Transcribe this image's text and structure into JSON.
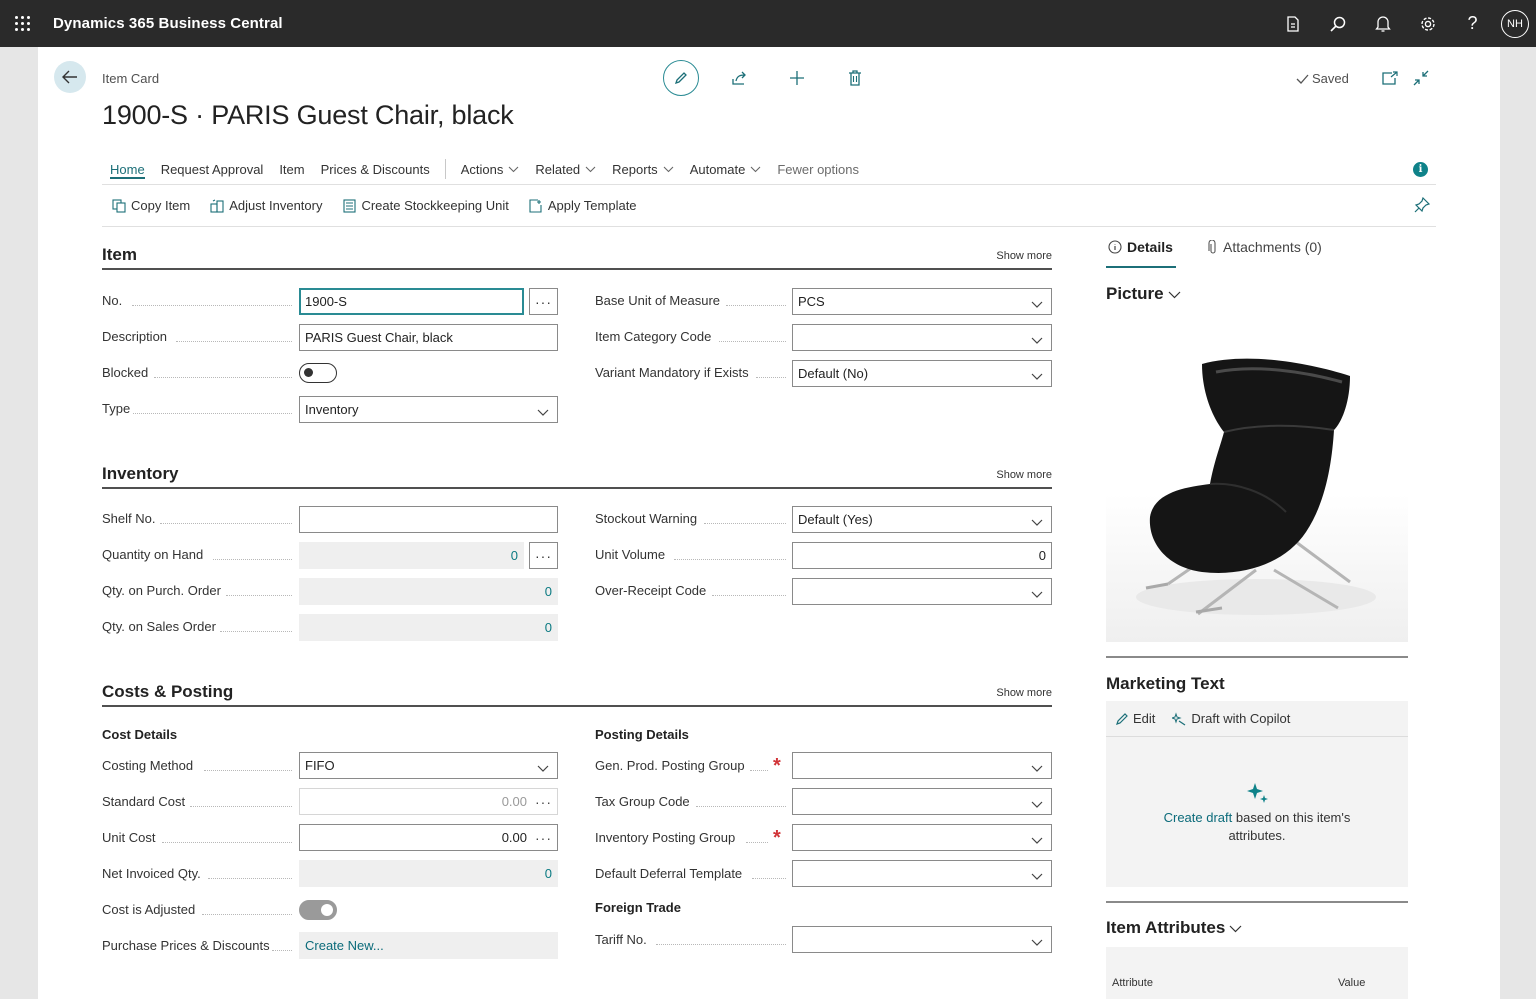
{
  "app": {
    "title": "Dynamics 365 Business Central",
    "user_initials": "NH"
  },
  "header": {
    "caption": "Item Card",
    "title": "1900-S · PARIS Guest Chair, black",
    "saved_label": "Saved"
  },
  "tabs": [
    {
      "label": "Home"
    },
    {
      "label": "Request Approval"
    },
    {
      "label": "Item"
    },
    {
      "label": "Prices & Discounts"
    },
    {
      "label": "Actions"
    },
    {
      "label": "Related"
    },
    {
      "label": "Reports"
    },
    {
      "label": "Automate"
    },
    {
      "label": "Fewer options"
    }
  ],
  "promoted_actions": [
    {
      "label": "Copy Item"
    },
    {
      "label": "Adjust Inventory"
    },
    {
      "label": "Create Stockkeeping Unit"
    },
    {
      "label": "Apply Template"
    }
  ],
  "sections": {
    "item": {
      "title": "Item",
      "show_more": "Show more",
      "no_label": "No.",
      "no_value": "1900-S",
      "description_label": "Description",
      "description_value": "PARIS Guest Chair, black",
      "blocked_label": "Blocked",
      "blocked": false,
      "type_label": "Type",
      "type_value": "Inventory",
      "base_uom_label": "Base Unit of Measure",
      "base_uom_value": "PCS",
      "item_category_label": "Item Category Code",
      "item_category_value": "",
      "variant_mandatory_label": "Variant Mandatory if Exists",
      "variant_mandatory_value": "Default (No)"
    },
    "inventory": {
      "title": "Inventory",
      "show_more": "Show more",
      "shelf_no_label": "Shelf No.",
      "shelf_no_value": "",
      "qty_on_hand_label": "Quantity on Hand",
      "qty_on_hand_value": "0",
      "qty_purch_label": "Qty. on Purch. Order",
      "qty_purch_value": "0",
      "qty_sales_label": "Qty. on Sales Order",
      "qty_sales_value": "0",
      "stockout_label": "Stockout Warning",
      "stockout_value": "Default (Yes)",
      "unit_volume_label": "Unit Volume",
      "unit_volume_value": "0",
      "over_receipt_label": "Over-Receipt Code",
      "over_receipt_value": ""
    },
    "costs": {
      "title": "Costs & Posting",
      "show_more": "Show more",
      "cost_details": "Cost Details",
      "costing_method_label": "Costing Method",
      "costing_method_value": "FIFO",
      "standard_cost_label": "Standard Cost",
      "standard_cost_value": "0.00",
      "unit_cost_label": "Unit Cost",
      "unit_cost_value": "0.00",
      "net_invoiced_label": "Net Invoiced Qty.",
      "net_invoiced_value": "0",
      "cost_adjusted_label": "Cost is Adjusted",
      "cost_adjusted": true,
      "purchase_prices_label": "Purchase Prices & Discounts",
      "purchase_prices_value": "Create New...",
      "posting_details": "Posting Details",
      "gen_prod_label": "Gen. Prod. Posting Group",
      "gen_prod_value": "",
      "tax_group_label": "Tax Group Code",
      "tax_group_value": "",
      "inv_posting_label": "Inventory Posting Group",
      "inv_posting_value": "",
      "deferral_label": "Default Deferral Template",
      "deferral_value": "",
      "foreign_trade": "Foreign Trade",
      "tariff_label": "Tariff No.",
      "tariff_value": ""
    }
  },
  "factbox": {
    "details_tab": "Details",
    "attachments_tab": "Attachments (0)",
    "picture_title": "Picture",
    "marketing_title": "Marketing Text",
    "edit_label": "Edit",
    "copilot_label": "Draft with Copilot",
    "create_draft_link": "Create draft",
    "create_draft_rest": " based on this item's",
    "create_draft_line2": "attributes.",
    "attributes_title": "Item Attributes",
    "attribute_col": "Attribute",
    "value_col": "Value"
  },
  "colors": {
    "accent": "#1c6f78",
    "topbar": "#2a2a2a",
    "required": "#d13438"
  }
}
